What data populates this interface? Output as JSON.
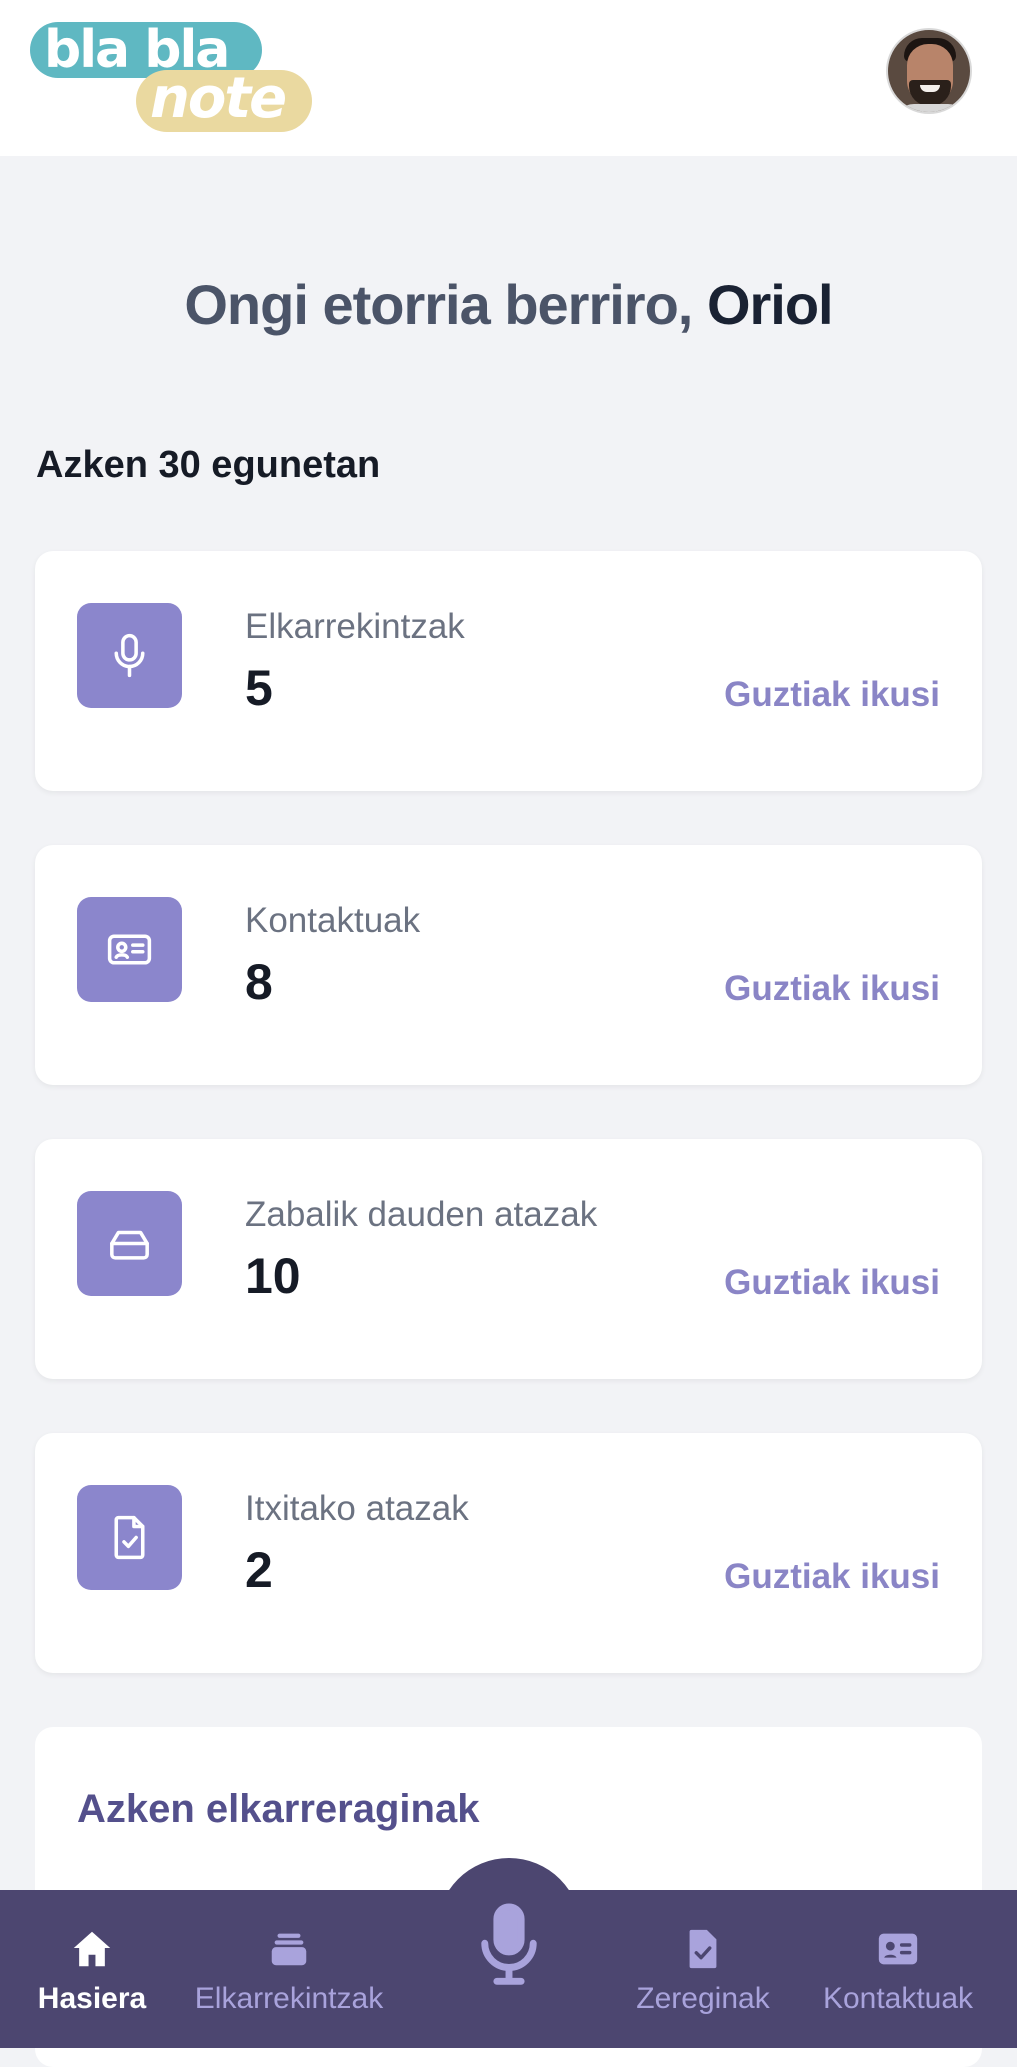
{
  "header": {
    "logo_line1": "bla bla",
    "logo_line2": "note",
    "avatar_alt": "user-avatar"
  },
  "welcome": {
    "greeting": "Ongi etorria berriro,",
    "name": "Oriol"
  },
  "section_title": "Azken 30 egunetan",
  "stats": [
    {
      "label": "Elkarrekintzak",
      "value": "5",
      "link": "Guztiak ikusi",
      "icon": "microphone-icon"
    },
    {
      "label": "Kontaktuak",
      "value": "8",
      "link": "Guztiak ikusi",
      "icon": "contact-card-icon"
    },
    {
      "label": "Zabalik dauden atazak",
      "value": "10",
      "link": "Guztiak ikusi",
      "icon": "inbox-tray-icon"
    },
    {
      "label": "Itxitako atazak",
      "value": "2",
      "link": "Guztiak ikusi",
      "icon": "document-check-icon"
    }
  ],
  "recent": {
    "title": "Azken elkarreraginak"
  },
  "nav": {
    "home": "Hasiera",
    "interactions": "Elkarrekintzak",
    "tasks": "Zereginak",
    "contacts": "Kontaktuak"
  },
  "colors": {
    "accent": "#8b86cc",
    "nav_bg": "#4c4670",
    "nav_inactive": "#a9a3dc",
    "logo_teal": "#5fb8c2",
    "logo_sand": "#ead9a0"
  }
}
